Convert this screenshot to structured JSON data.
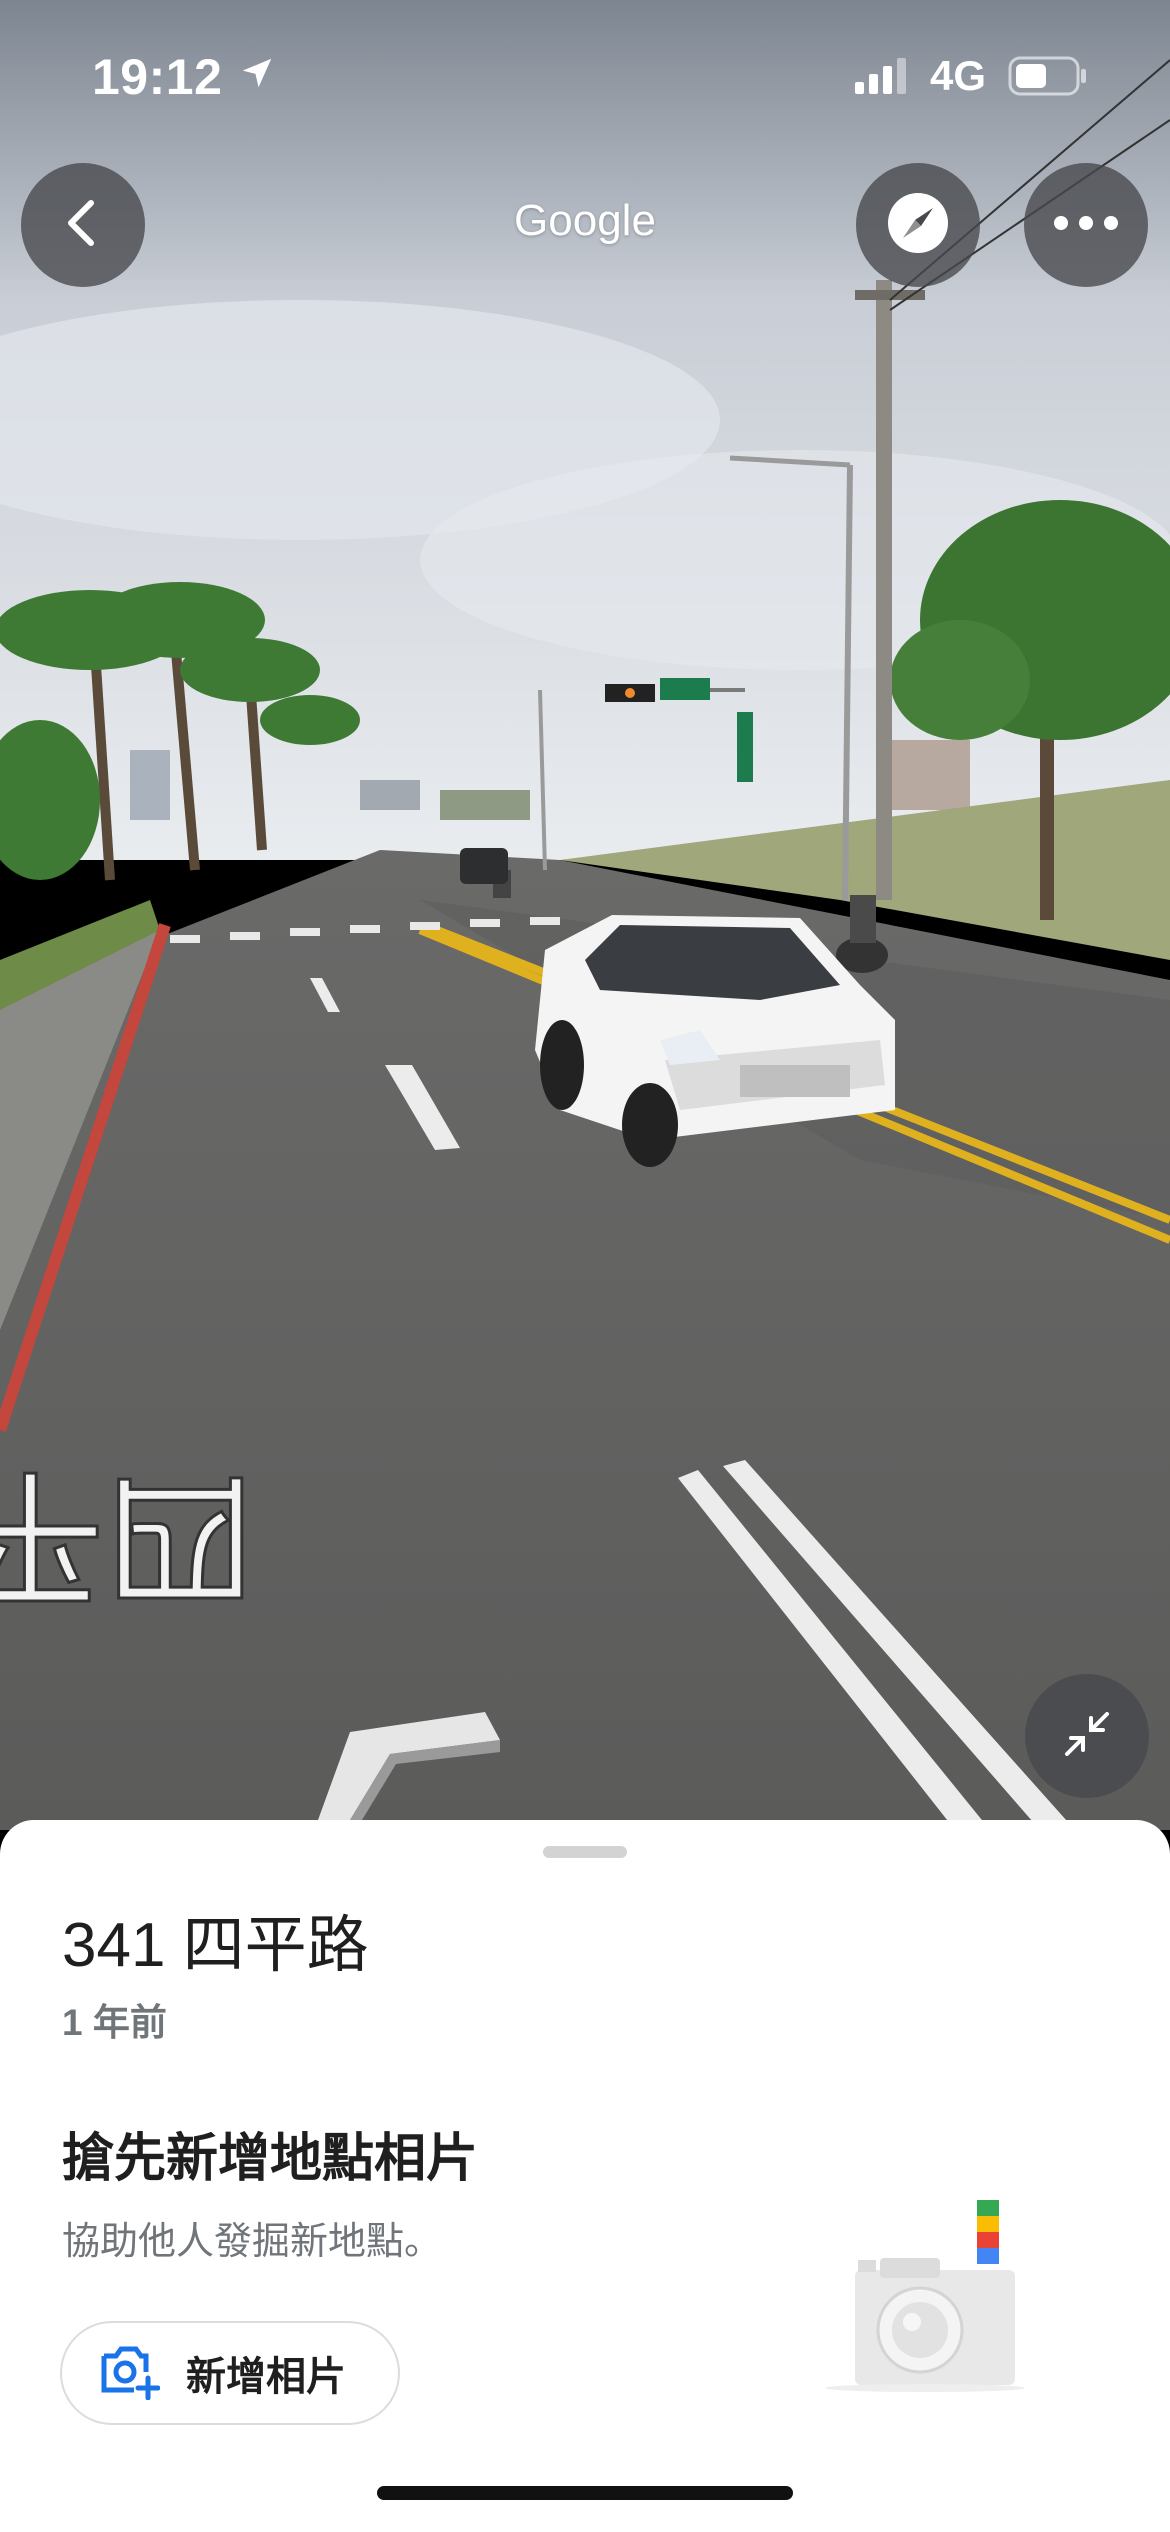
{
  "status_bar": {
    "time": "19:12",
    "network": "4G"
  },
  "header": {
    "title": "Google"
  },
  "scene": {
    "road_text": "四平路"
  },
  "sheet": {
    "place_title": "341 四平路",
    "photo_age": "1 年前",
    "promo_title": "搶先新增地點相片",
    "promo_subtitle": "協助他人發掘新地點。",
    "add_photo_label": "新增相片"
  },
  "icons": {
    "back": "chevron-left-icon",
    "compass": "compass-icon",
    "more": "more-horizontal-icon",
    "minimize": "minimize-arrows-icon",
    "add_photo": "add-photo-camera-icon",
    "location": "location-arrow-icon"
  },
  "colors": {
    "accent_blue": "#1a73e8",
    "button_overlay": "#46484c",
    "google_red": "#ea4335",
    "google_yellow": "#fbbc04",
    "google_green": "#34a853",
    "google_blue": "#4285f4"
  }
}
